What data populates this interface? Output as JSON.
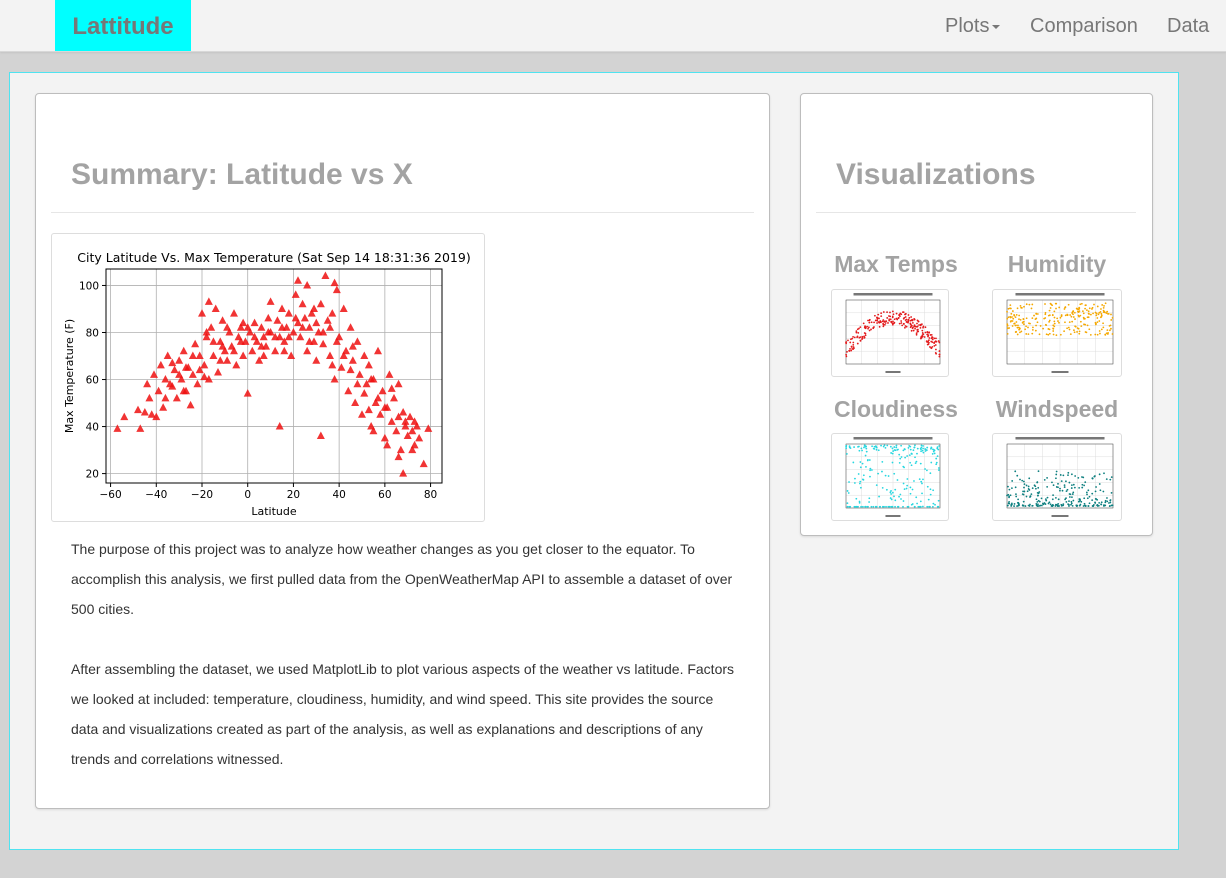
{
  "navbar": {
    "brand": "Lattitude",
    "links": {
      "plots": "Plots",
      "comparison": "Comparison",
      "data": "Data"
    },
    "brand_color": "#00ffff"
  },
  "summary": {
    "title": "Summary: Latitude vs X",
    "paragraph_1": "The purpose of this project was to analyze how weather changes as you get closer to the equator. To accomplish this analysis, we first pulled data from the OpenWeatherMap API to assemble a dataset of over 500 cities.",
    "paragraph_2": "After assembling the dataset, we used MatplotLib to plot various aspects of the weather vs latitude. Factors we looked at included: temperature, cloudiness, humidity, and wind speed. This site provides the source data and visualizations created as part of the analysis, as well as explanations and descriptions of any trends and correlations witnessed."
  },
  "visualizations": {
    "title": "Visualizations",
    "items": [
      {
        "label": "Max Temps",
        "color": "#e31a1c"
      },
      {
        "label": "Humidity",
        "color": "#f5a800"
      },
      {
        "label": "Cloudiness",
        "color": "#26d7e0"
      },
      {
        "label": "Windspeed",
        "color": "#0d7f7f"
      }
    ]
  },
  "chart_data": {
    "type": "scatter",
    "title": "City Latitude Vs. Max Temperature (Sat Sep 14 18:31:36 2019)",
    "xlabel": "Latitude",
    "ylabel": "Max Temperature (F)",
    "xlim": [
      -62,
      85
    ],
    "ylim": [
      16,
      107
    ],
    "xticks": [
      -60,
      -40,
      -20,
      0,
      20,
      40,
      60,
      80
    ],
    "yticks": [
      20,
      40,
      60,
      80,
      100
    ],
    "grid": true,
    "marker": "triangle",
    "color": "#ee1111",
    "series": [
      {
        "points": [
          [
            -57,
            39
          ],
          [
            -54,
            44
          ],
          [
            -47,
            39
          ],
          [
            -45,
            46
          ],
          [
            -44,
            58
          ],
          [
            -43,
            52
          ],
          [
            -42,
            45
          ],
          [
            -41,
            62
          ],
          [
            -39,
            55
          ],
          [
            -38,
            66
          ],
          [
            -37,
            48
          ],
          [
            -36,
            60
          ],
          [
            -35,
            70
          ],
          [
            -33,
            57
          ],
          [
            -32,
            64
          ],
          [
            -31,
            52
          ],
          [
            -30,
            68
          ],
          [
            -29,
            60
          ],
          [
            -28,
            72
          ],
          [
            -27,
            55
          ],
          [
            -26,
            65
          ],
          [
            -25,
            49
          ],
          [
            -24,
            62
          ],
          [
            -23,
            75
          ],
          [
            -22,
            58
          ],
          [
            -21,
            70
          ],
          [
            -20,
            88
          ],
          [
            -19,
            66
          ],
          [
            -18,
            78
          ],
          [
            -17,
            60
          ],
          [
            -16,
            82
          ],
          [
            -15,
            70
          ],
          [
            -14,
            90
          ],
          [
            -13,
            63
          ],
          [
            -12,
            76
          ],
          [
            -11,
            85
          ],
          [
            -10,
            72
          ],
          [
            -9,
            68
          ],
          [
            -8,
            80
          ],
          [
            -7,
            74
          ],
          [
            -6,
            88
          ],
          [
            -5,
            66
          ],
          [
            -4,
            78
          ],
          [
            -3,
            82
          ],
          [
            -2,
            70
          ],
          [
            -1,
            76
          ],
          [
            0,
            54
          ],
          [
            1,
            80
          ],
          [
            2,
            72
          ],
          [
            3,
            84
          ],
          [
            4,
            76
          ],
          [
            5,
            68
          ],
          [
            6,
            82
          ],
          [
            7,
            78
          ],
          [
            8,
            74
          ],
          [
            9,
            86
          ],
          [
            10,
            80
          ],
          [
            12,
            72
          ],
          [
            13,
            85
          ],
          [
            14,
            78
          ],
          [
            15,
            90
          ],
          [
            16,
            76
          ],
          [
            17,
            82
          ],
          [
            18,
            88
          ],
          [
            19,
            70
          ],
          [
            20,
            80
          ],
          [
            21,
            96
          ],
          [
            22,
            84
          ],
          [
            23,
            78
          ],
          [
            24,
            92
          ],
          [
            25,
            86
          ],
          [
            26,
            72
          ],
          [
            27,
            82
          ],
          [
            28,
            88
          ],
          [
            29,
            76
          ],
          [
            30,
            68
          ],
          [
            31,
            80
          ],
          [
            32,
            92
          ],
          [
            33,
            75
          ],
          [
            34,
            104
          ],
          [
            35,
            85
          ],
          [
            36,
            70
          ],
          [
            37,
            88
          ],
          [
            38,
            60
          ],
          [
            39,
            98
          ],
          [
            40,
            78
          ],
          [
            41,
            65
          ],
          [
            42,
            90
          ],
          [
            43,
            72
          ],
          [
            44,
            55
          ],
          [
            45,
            82
          ],
          [
            46,
            68
          ],
          [
            47,
            50
          ],
          [
            48,
            76
          ],
          [
            49,
            62
          ],
          [
            50,
            45
          ],
          [
            51,
            70
          ],
          [
            52,
            58
          ],
          [
            53,
            66
          ],
          [
            54,
            40
          ],
          [
            55,
            60
          ],
          [
            56,
            50
          ],
          [
            57,
            72
          ],
          [
            58,
            45
          ],
          [
            59,
            55
          ],
          [
            60,
            35
          ],
          [
            61,
            48
          ],
          [
            62,
            62
          ],
          [
            63,
            42
          ],
          [
            64,
            52
          ],
          [
            65,
            38
          ],
          [
            66,
            58
          ],
          [
            67,
            30
          ],
          [
            68,
            46
          ],
          [
            69,
            40
          ],
          [
            70,
            36
          ],
          [
            71,
            44
          ],
          [
            72,
            38
          ],
          [
            73,
            32
          ],
          [
            74,
            40
          ],
          [
            75,
            35
          ],
          [
            77,
            24
          ],
          [
            79,
            39
          ],
          [
            -40,
            44
          ],
          [
            -36,
            52
          ],
          [
            -33,
            67
          ],
          [
            -30,
            62
          ],
          [
            -27,
            65
          ],
          [
            -24,
            70
          ],
          [
            -21,
            64
          ],
          [
            -18,
            80
          ],
          [
            -15,
            76
          ],
          [
            -12,
            68
          ],
          [
            -9,
            82
          ],
          [
            -6,
            72
          ],
          [
            -3,
            76
          ],
          [
            0,
            82
          ],
          [
            3,
            78
          ],
          [
            6,
            74
          ],
          [
            9,
            80
          ],
          [
            12,
            78
          ],
          [
            15,
            82
          ],
          [
            18,
            78
          ],
          [
            21,
            86
          ],
          [
            24,
            82
          ],
          [
            27,
            76
          ],
          [
            30,
            84
          ],
          [
            33,
            80
          ],
          [
            36,
            82
          ],
          [
            39,
            76
          ],
          [
            42,
            70
          ],
          [
            45,
            64
          ],
          [
            48,
            58
          ],
          [
            51,
            54
          ],
          [
            54,
            60
          ],
          [
            57,
            52
          ],
          [
            60,
            48
          ],
          [
            63,
            56
          ],
          [
            66,
            44
          ],
          [
            69,
            42
          ],
          [
            72,
            30
          ],
          [
            26,
            100
          ],
          [
            22,
            102
          ],
          [
            -17,
            93
          ],
          [
            10,
            93
          ],
          [
            38,
            101
          ],
          [
            14,
            40
          ],
          [
            32,
            36
          ],
          [
            -48,
            47
          ],
          [
            -34,
            58
          ],
          [
            -28,
            55
          ],
          [
            -19,
            61
          ],
          [
            -11,
            74
          ],
          [
            -2,
            84
          ],
          [
            7,
            70
          ],
          [
            16,
            72
          ],
          [
            29,
            90
          ],
          [
            37,
            66
          ],
          [
            46,
            74
          ],
          [
            53,
            47
          ],
          [
            61,
            32
          ],
          [
            66,
            27
          ],
          [
            68,
            20
          ],
          [
            73,
            42
          ],
          [
            55,
            38
          ]
        ]
      }
    ]
  }
}
